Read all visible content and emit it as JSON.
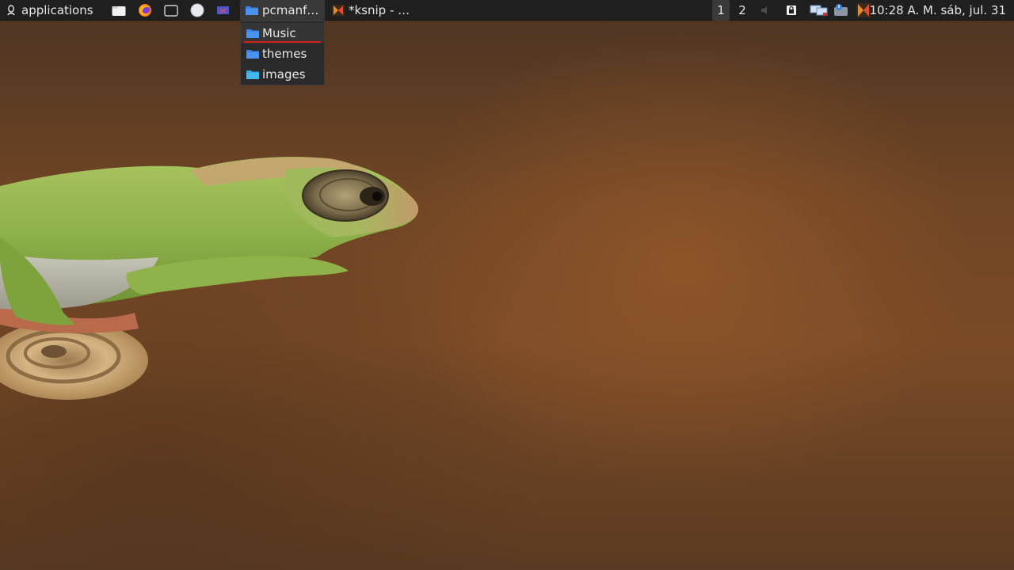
{
  "panel": {
    "apps_label": "applications",
    "launchers": [
      {
        "icon": "file-manager-icon"
      },
      {
        "icon": "firefox-icon"
      },
      {
        "icon": "terminal-icon"
      },
      {
        "icon": "globe-icon"
      },
      {
        "icon": "screen-icon"
      }
    ],
    "tasks": [
      {
        "label": "pcmanf…",
        "icon": "folder-icon",
        "active": true
      },
      {
        "label": "*ksnip - …",
        "icon": "ksnip-icon",
        "active": false
      }
    ],
    "workspaces": [
      "1",
      "2"
    ],
    "tray": [
      "volume-icon",
      "lock-icon",
      "network-icon",
      "notification-icon",
      "ksnip-tray-icon"
    ],
    "clock": "10:28 A. M. sáb, jul. 31"
  },
  "dropdown": {
    "items": [
      {
        "label": "Music",
        "icon": "folder-icon",
        "hover": true
      },
      {
        "label": "themes",
        "icon": "folder-icon",
        "hover": false
      },
      {
        "label": "images",
        "icon": "folder-icon",
        "hover": false
      }
    ]
  },
  "colors": {
    "panel_bg": "#1f1f1f",
    "folder_blue": "#3b82e8",
    "hover_underline": "#d0201a"
  }
}
